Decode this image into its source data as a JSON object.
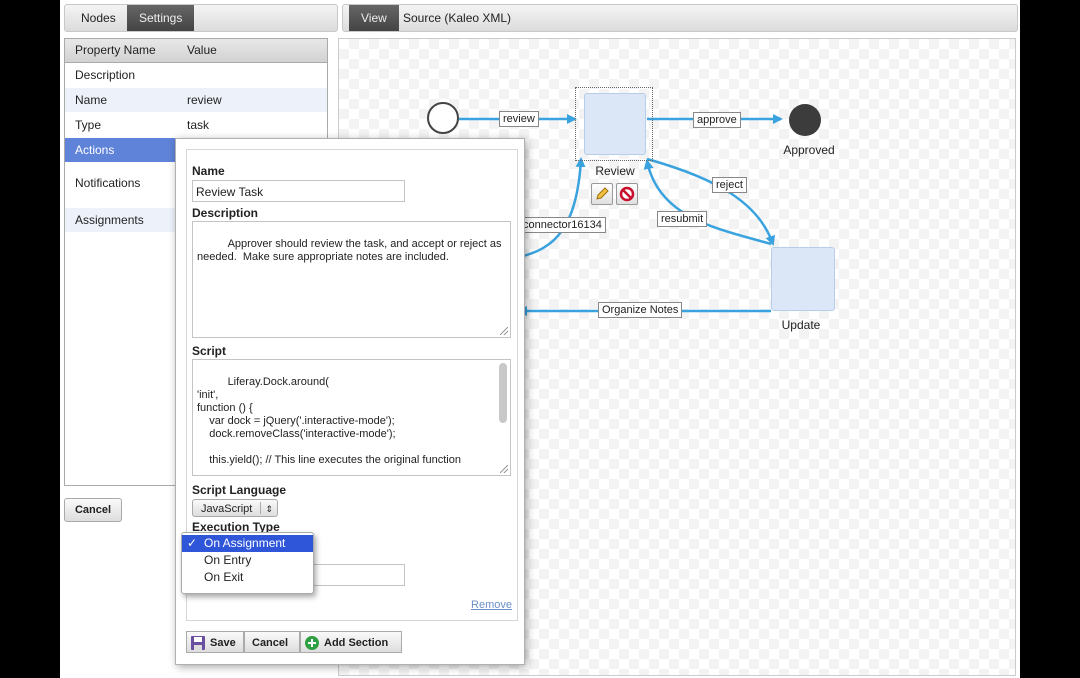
{
  "left_tabs": [
    "Nodes",
    "Settings"
  ],
  "right_tabs": [
    "View",
    "Source (Kaleo XML)"
  ],
  "properties": {
    "headers": [
      "Property Name",
      "Value"
    ],
    "rows": [
      {
        "name": "Description",
        "value": ""
      },
      {
        "name": "Name",
        "value": "review"
      },
      {
        "name": "Type",
        "value": "task"
      },
      {
        "name": "Actions",
        "value": ""
      },
      {
        "name": "Notifications",
        "value": ""
      },
      {
        "name": "Assignments",
        "value": ""
      }
    ]
  },
  "cancel_label": "Cancel",
  "editor": {
    "name_label": "Name",
    "name_value": "Review Task",
    "description_label": "Description",
    "description_value": "Approver should review the task, and accept or reject as\nneeded.  Make sure appropriate notes are included.",
    "script_label": "Script",
    "script_value": "Liferay.Dock.around(\n'init',\nfunction () {\n    var dock = jQuery('.interactive-mode');\n    dock.removeClass('interactive-mode');\n\n    this.yield(); // This line executes the original function\n\n    dock.addClass('interactive-mode'); // This line now adds",
    "script_language_label": "Script Language",
    "script_language_value": "JavaScript",
    "execution_type_label": "Execution Type",
    "execution_options": [
      "On Assignment",
      "On Entry",
      "On Exit"
    ],
    "execution_selected": "On Assignment",
    "check_mark": "✓",
    "remove_label": "Remove",
    "buttons": {
      "save": "Save",
      "cancel": "Cancel",
      "add_section": "Add Section"
    }
  },
  "diagram": {
    "nodes": {
      "review": "Review",
      "approved": "Approved",
      "update": "Update"
    },
    "connectors": [
      "review",
      "approve",
      "reject",
      "resubmit",
      "connector16134",
      "Organize Notes"
    ]
  },
  "colors": {
    "connector": "#3aa3df",
    "selected_row": "#5f83d9",
    "dropdown_selected": "#2f56d9",
    "task_fill": "#dbe7f6"
  }
}
